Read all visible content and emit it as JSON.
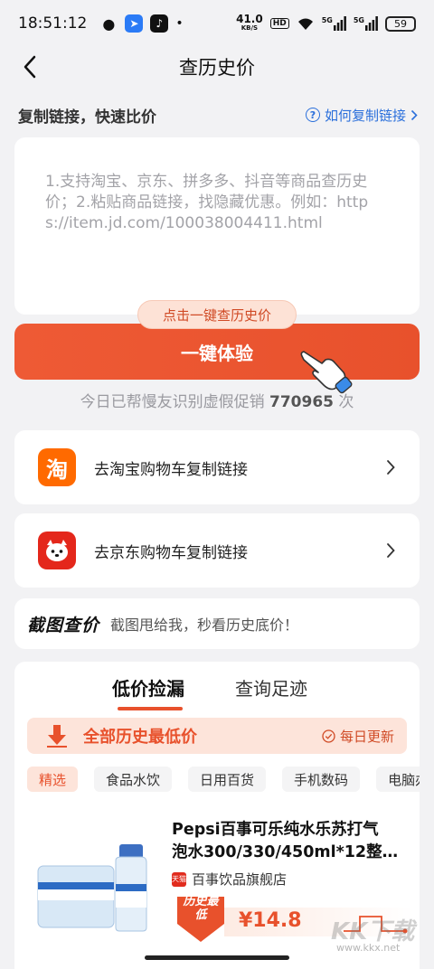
{
  "status_bar": {
    "time": "18:51:12",
    "net_speed": "41.0",
    "net_unit": "KB/S",
    "hd": "HD",
    "signal_1": "5G",
    "signal_2": "5G",
    "battery": "59"
  },
  "nav": {
    "title": "查历史价"
  },
  "copy_section": {
    "title": "复制链接，快速比价",
    "help_link": "如何复制链接"
  },
  "paste_box": {
    "placeholder": "1.支持淘宝、京东、拼多多、抖音等商品查历史价；2.粘贴商品链接，找隐藏优惠。例如：https://item.jd.com/100038004411.html"
  },
  "cta": {
    "tip": "点击一键查历史价",
    "button_label": "一键体验"
  },
  "stats": {
    "prefix": "今日已帮慢友识别虚假促销 ",
    "count": "770965",
    "suffix": " 次"
  },
  "link_cards": [
    {
      "logo_char": "淘",
      "label": "去淘宝购物车复制链接",
      "color": "#ff6a00"
    },
    {
      "logo_char": "",
      "label": "去京东购物车复制链接",
      "color": "#e4271b"
    }
  ],
  "screenshot_search": {
    "title": "截图查价",
    "desc": "截图甩给我，秒看历史底价！"
  },
  "tabs": [
    {
      "label": "低价捡漏",
      "active": true
    },
    {
      "label": "查询足迹",
      "active": false
    }
  ],
  "lowest_banner": {
    "title": "全部历史最低价",
    "daily": "每日更新"
  },
  "chips": [
    "精选",
    "食品水饮",
    "日用百货",
    "手机数码",
    "电脑办"
  ],
  "product": {
    "title_line1": "Pepsi百事可乐纯水乐苏打气",
    "title_line2": "泡水300/330/450ml*12整箱...",
    "shop_badge": "天猫",
    "shop": "百事饮品旗舰店",
    "price_tag": "历史最低",
    "price": "¥14.8"
  },
  "watermark": {
    "brand": "KK下载",
    "url": "www.kkx.net"
  },
  "colors": {
    "accent": "#e8512c",
    "link": "#2a6fdb",
    "background": "#f2f2f4"
  }
}
